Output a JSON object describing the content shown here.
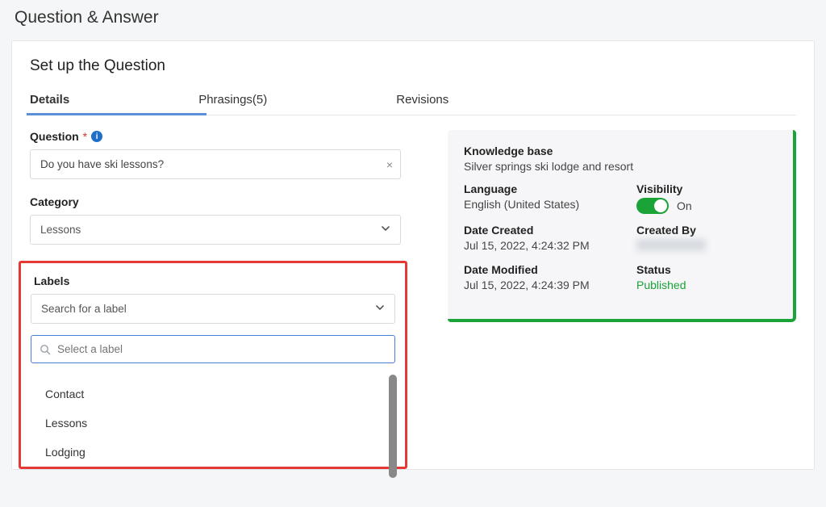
{
  "page_title": "Question & Answer",
  "card_title": "Set up the Question",
  "tabs": {
    "details": "Details",
    "phrasings": "Phrasings(5)",
    "revisions": "Revisions"
  },
  "question": {
    "label": "Question",
    "required_mark": "*",
    "value": "Do you have ski lessons?"
  },
  "category": {
    "label": "Category",
    "selected": "Lessons"
  },
  "labels": {
    "label": "Labels",
    "select_placeholder": "Search for a label",
    "search_placeholder": "Select a label",
    "options": [
      "Contact",
      "Lessons",
      "Lodging"
    ]
  },
  "info": {
    "kb_label": "Knowledge base",
    "kb_value": "Silver springs ski lodge and resort",
    "lang_label": "Language",
    "lang_value": "English (United States)",
    "visibility_label": "Visibility",
    "visibility_value": "On",
    "created_label": "Date Created",
    "created_value": "Jul 15, 2022, 4:24:32 PM",
    "createdby_label": "Created By",
    "modified_label": "Date Modified",
    "modified_value": "Jul 15, 2022, 4:24:39 PM",
    "status_label": "Status",
    "status_value": "Published"
  }
}
